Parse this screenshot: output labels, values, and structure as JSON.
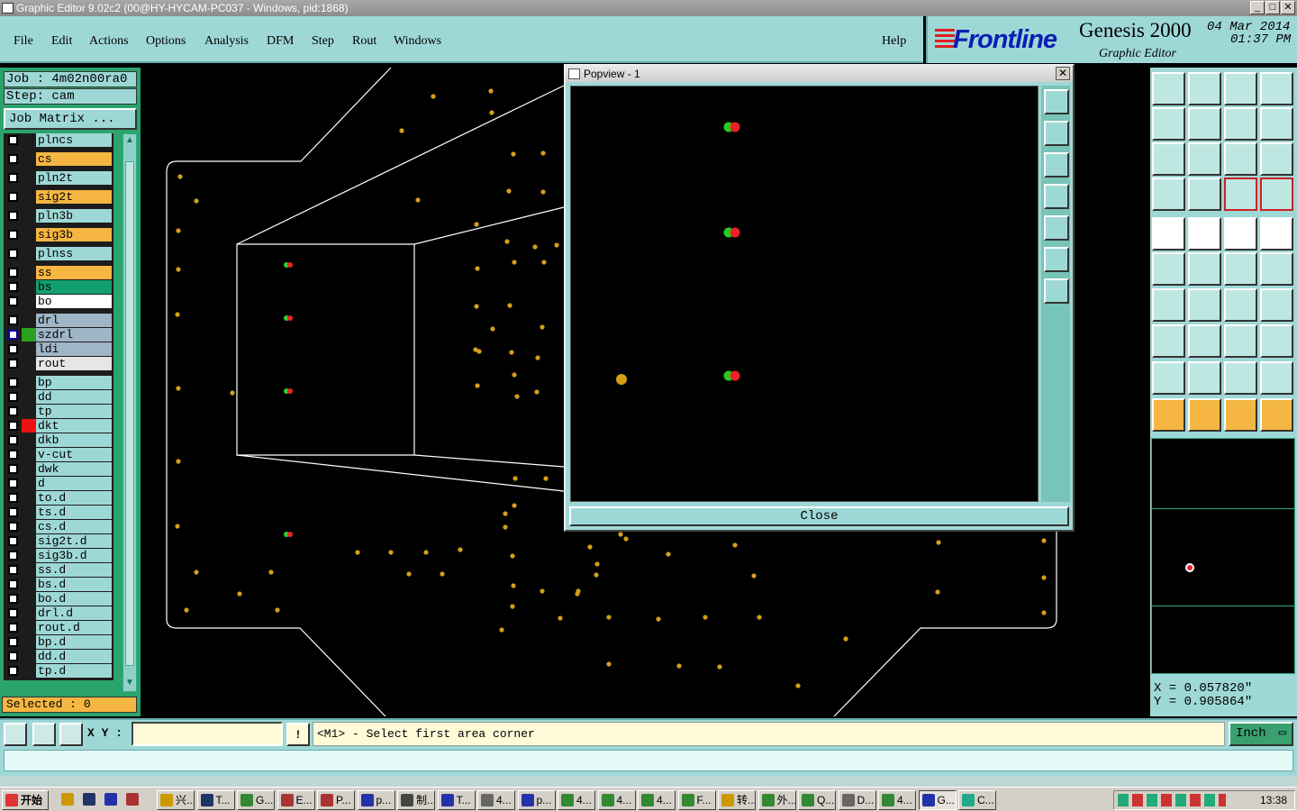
{
  "window": {
    "title": "Graphic Editor 9.02c2 (00@HY-HYCAM-PC037 - Windows, pid:1868)"
  },
  "menu": [
    "File",
    "Edit",
    "Actions",
    "Options",
    "Analysis",
    "DFM",
    "Step",
    "Rout",
    "Windows"
  ],
  "help": "Help",
  "brand": {
    "logo": "Frontline",
    "product": "Genesis 2000",
    "subtitle": "Graphic Editor",
    "date": "04 Mar 2014",
    "time": "01:37 PM"
  },
  "job": {
    "job": "Job : 4m02n00ra0",
    "step": "Step: cam",
    "matrix_button": "Job Matrix ..."
  },
  "layers": [
    {
      "name": "plncs",
      "color": "#9ed8d6"
    },
    {
      "name": "cs",
      "color": "#f5b642"
    },
    {
      "name": "pln2t",
      "color": "#9ed8d6"
    },
    {
      "name": "sig2t",
      "color": "#f5b642"
    },
    {
      "name": "pln3b",
      "color": "#9ed8d6"
    },
    {
      "name": "sig3b",
      "color": "#f5b642"
    },
    {
      "name": "plnss",
      "color": "#9ed8d6"
    },
    {
      "name": "ss",
      "color": "#f5b642"
    },
    {
      "name": "bs",
      "color": "#13a06e"
    },
    {
      "name": "bo",
      "color": "#ffffff"
    },
    {
      "name": "drl",
      "color": "#9fb6c6"
    },
    {
      "name": "szdrl",
      "color": "#9fb6c6",
      "active": true
    },
    {
      "name": "ldi",
      "color": "#9fb6c6"
    },
    {
      "name": "rout",
      "color": "#e6e6e6"
    },
    {
      "name": "bp",
      "color": "#9ed8d6"
    },
    {
      "name": "dd",
      "color": "#9ed8d6"
    },
    {
      "name": "tp",
      "color": "#9ed8d6"
    },
    {
      "name": "dkt",
      "color": "#9ed8d6",
      "marked": true
    },
    {
      "name": "dkb",
      "color": "#9ed8d6"
    },
    {
      "name": "v-cut",
      "color": "#9ed8d6"
    },
    {
      "name": "dwk",
      "color": "#9ed8d6"
    },
    {
      "name": "d",
      "color": "#9ed8d6"
    },
    {
      "name": "to.d",
      "color": "#9ed8d6"
    },
    {
      "name": "ts.d",
      "color": "#9ed8d6"
    },
    {
      "name": "cs.d",
      "color": "#9ed8d6"
    },
    {
      "name": "sig2t.d",
      "color": "#9ed8d6"
    },
    {
      "name": "sig3b.d",
      "color": "#9ed8d6"
    },
    {
      "name": "ss.d",
      "color": "#9ed8d6"
    },
    {
      "name": "bs.d",
      "color": "#9ed8d6"
    },
    {
      "name": "bo.d",
      "color": "#9ed8d6"
    },
    {
      "name": "drl.d",
      "color": "#9ed8d6"
    },
    {
      "name": "rout.d",
      "color": "#9ed8d6"
    },
    {
      "name": "bp.d",
      "color": "#9ed8d6"
    },
    {
      "name": "dd.d",
      "color": "#9ed8d6"
    },
    {
      "name": "tp.d",
      "color": "#9ed8d6"
    }
  ],
  "selected": "Selected : 0",
  "popview": {
    "title": "Popview - 1",
    "close": "Close"
  },
  "coords": {
    "x": "X = 0.057820\"",
    "y": "Y = 0.905864\""
  },
  "bottom": {
    "xy_label": "X Y :",
    "xy_value": "",
    "bang": "!",
    "prompt": "<M1> - Select first area corner",
    "unit": "Inch"
  },
  "taskbar": {
    "start": "开始",
    "tasks": [
      "兴...",
      "T...",
      "G...",
      "E...",
      "P...",
      "p...",
      "制...",
      "T...",
      "4...",
      "p...",
      "4...",
      "4...",
      "4...",
      "F...",
      "转...",
      "外...",
      "Q...",
      "D...",
      "4...",
      "G...",
      "C..."
    ],
    "clock": "13:38"
  },
  "colors": {
    "accent": "#9ed8d6",
    "layer_bg": "#2aa46c",
    "pad": "#d4a017",
    "outline": "#ffffff"
  }
}
